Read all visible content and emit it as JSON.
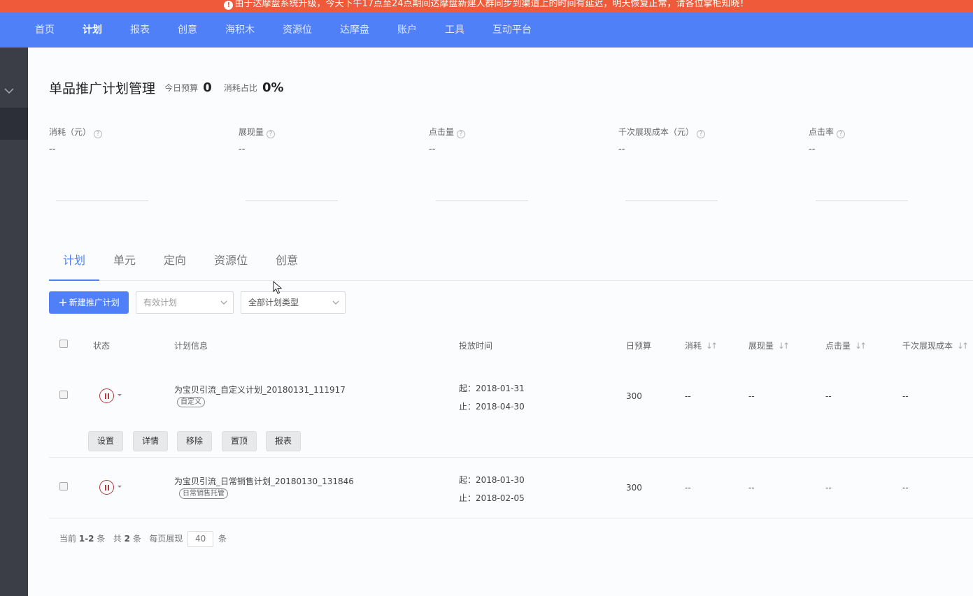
{
  "banner": {
    "text": "由于达摩盘系统升级，今天下午17点至24点期间达摩盘新建人群同步到渠道上的时间有延迟，明天恢复正常，请各位掌柜知晓！"
  },
  "topnav": {
    "items": [
      {
        "label": "首页"
      },
      {
        "label": "计划",
        "active": true
      },
      {
        "label": "报表"
      },
      {
        "label": "创意"
      },
      {
        "label": "海积木"
      },
      {
        "label": "资源位"
      },
      {
        "label": "达摩盘"
      },
      {
        "label": "账户"
      },
      {
        "label": "工具"
      },
      {
        "label": "互动平台"
      }
    ]
  },
  "page": {
    "title": "单品推广计划管理",
    "budget_label": "今日预算",
    "budget_value": "0",
    "ratio_label": "消耗占比",
    "ratio_value": "0%"
  },
  "metrics": [
    {
      "label": "消耗（元）",
      "value": "--"
    },
    {
      "label": "展现量",
      "value": "--"
    },
    {
      "label": "点击量",
      "value": "--"
    },
    {
      "label": "千次展现成本（元）",
      "value": "--"
    },
    {
      "label": "点击率",
      "value": "--"
    }
  ],
  "tabs": [
    {
      "label": "计划",
      "active": true
    },
    {
      "label": "单元"
    },
    {
      "label": "定向"
    },
    {
      "label": "资源位"
    },
    {
      "label": "创意"
    }
  ],
  "toolbar": {
    "new_button": "新建推广计划",
    "filter_status": "有效计划",
    "filter_type": "全部计划类型"
  },
  "table": {
    "headers": {
      "status": "状态",
      "info": "计划信息",
      "time": "投放时间",
      "budget": "日预算",
      "cost": "消耗",
      "impressions": "展现量",
      "clicks": "点击量",
      "cpm": "千次展现成本"
    },
    "rows": [
      {
        "name": "为宝贝引流_自定义计划_20180131_111917",
        "tag": "自定义",
        "start": "起：2018-01-31",
        "end": "止：2018-04-30",
        "budget": "300",
        "cost": "--",
        "impressions": "--",
        "clicks": "--",
        "cpm": "--"
      },
      {
        "name": "为宝贝引流_日常销售计划_20180130_131846",
        "tag": "日常销售托管",
        "start": "起：2018-01-30",
        "end": "止：2018-02-05",
        "budget": "300",
        "cost": "--",
        "impressions": "--",
        "clicks": "--",
        "cpm": "--"
      }
    ],
    "row_actions": [
      "设置",
      "详情",
      "移除",
      "置顶",
      "报表"
    ]
  },
  "pager": {
    "current_prefix": "当前",
    "current_range": "1-2",
    "current_suffix": "条",
    "total_prefix": "共",
    "total": "2",
    "total_suffix": "条",
    "per_page_label": "每页展现",
    "per_page": "40",
    "per_page_suffix": "条"
  },
  "colors": {
    "brand": "#4f80f8",
    "banner": "#ef5a3a",
    "sidebar": "#3b3e47",
    "paused": "#b03a3a"
  }
}
